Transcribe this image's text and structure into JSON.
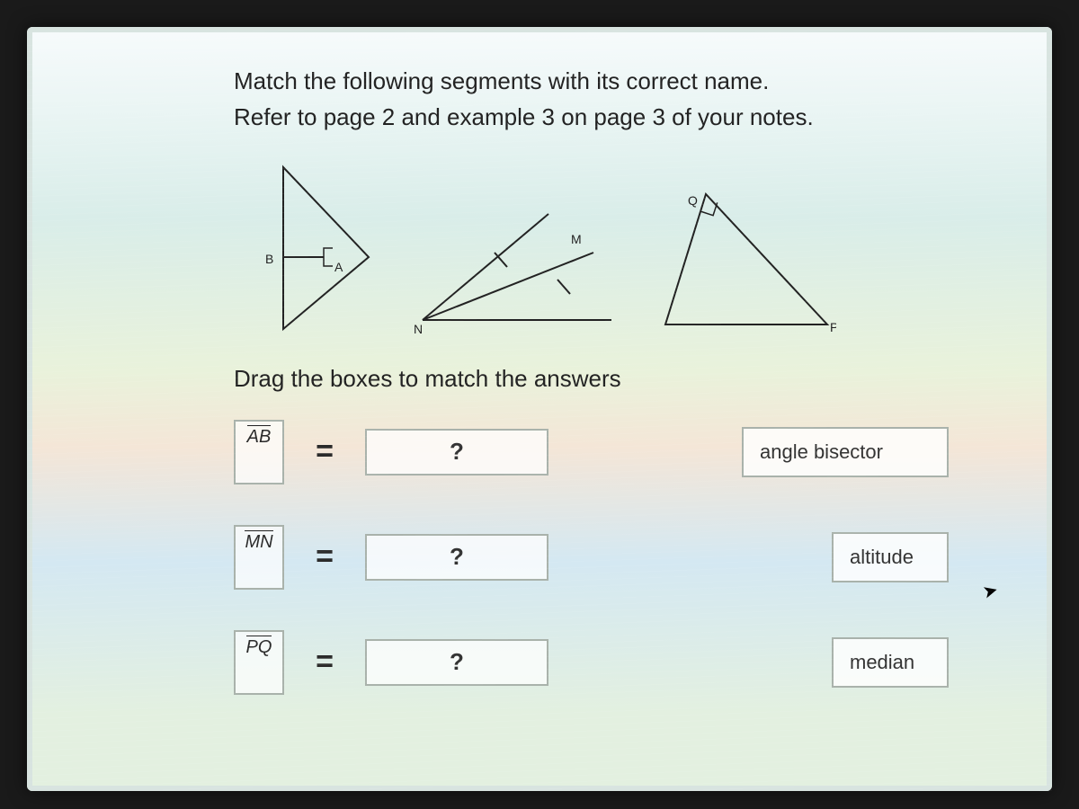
{
  "instructions": {
    "line1": "Match the following segments with its correct name.",
    "line2": "Refer to page 2 and example 3 on page 3 of your notes."
  },
  "figure_labels": {
    "tri1": {
      "A": "A",
      "B": "B"
    },
    "tri2": {
      "M": "M",
      "N": "N"
    },
    "tri3": {
      "P": "P",
      "Q": "Q"
    }
  },
  "drag_instruction": "Drag the boxes to match the answers",
  "rows": [
    {
      "segment": "AB",
      "equals": "=",
      "slot": "?",
      "answer": "angle bisector"
    },
    {
      "segment": "MN",
      "equals": "=",
      "slot": "?",
      "answer": "altitude"
    },
    {
      "segment": "PQ",
      "equals": "=",
      "slot": "?",
      "answer": "median"
    }
  ]
}
